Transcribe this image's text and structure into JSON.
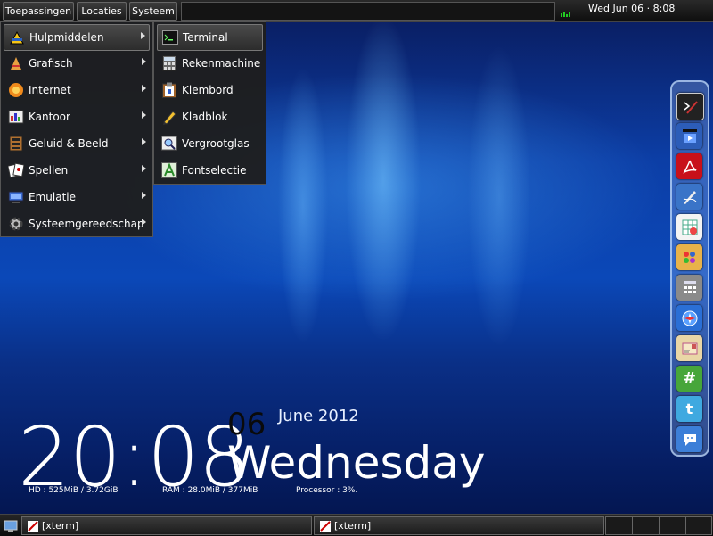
{
  "top_panel": {
    "menus": [
      "Toepassingen",
      "Locaties",
      "Systeem"
    ],
    "clock": "Wed Jun 06 ·  8:08"
  },
  "apps_menu": {
    "items": [
      {
        "label": "Hulpmiddelen",
        "icon": "tools-icon"
      },
      {
        "label": "Grafisch",
        "icon": "graphics-icon"
      },
      {
        "label": "Internet",
        "icon": "internet-icon"
      },
      {
        "label": "Kantoor",
        "icon": "office-icon"
      },
      {
        "label": "Geluid & Beeld",
        "icon": "media-icon"
      },
      {
        "label": "Spellen",
        "icon": "games-icon"
      },
      {
        "label": "Emulatie",
        "icon": "emulation-icon"
      },
      {
        "label": "Systeemgereedschap",
        "icon": "gear-icon"
      }
    ]
  },
  "submenu": {
    "items": [
      {
        "label": "Terminal",
        "icon": "terminal-icon"
      },
      {
        "label": "Rekenmachine",
        "icon": "calculator-icon"
      },
      {
        "label": "Klembord",
        "icon": "clipboard-icon"
      },
      {
        "label": "Kladblok",
        "icon": "pencil-icon"
      },
      {
        "label": "Vergrootglas",
        "icon": "magnifier-icon"
      },
      {
        "label": "Fontselectie",
        "icon": "font-icon"
      }
    ]
  },
  "dock": {
    "icons": [
      "terminal-icon",
      "video-icon",
      "pdf-icon",
      "draw-icon",
      "spreadsheet-icon",
      "palette-icon",
      "calculator-icon",
      "compass-icon",
      "mail-icon",
      "hash-icon",
      "twitter-icon",
      "chat-icon"
    ]
  },
  "conky": {
    "time": "20:08",
    "day": "06",
    "month_year": "June 2012",
    "weekday": "Wednesday",
    "hd": "HD :   525MiB / 3.72GiB",
    "ram": "RAM :   28.0MiB / 377MiB",
    "cpu": "Processor :   3%."
  },
  "taskbar": {
    "tasks": [
      "[xterm]",
      "[xterm]"
    ]
  }
}
